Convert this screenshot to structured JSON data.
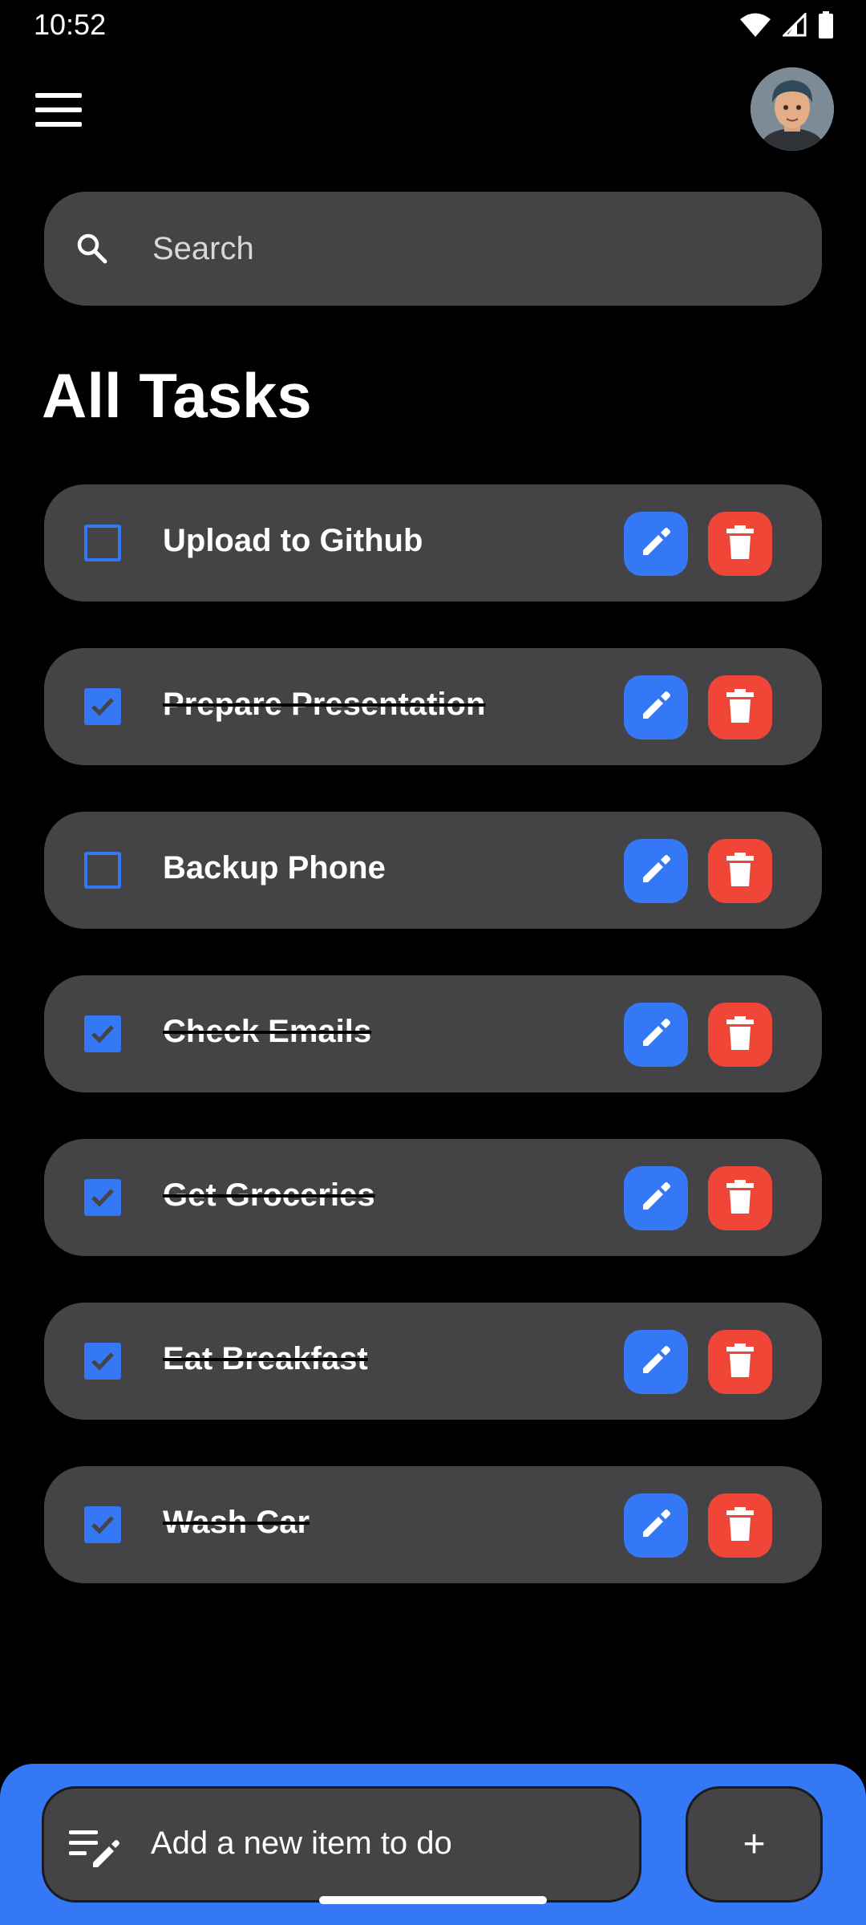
{
  "status_bar": {
    "time": "10:52",
    "icons": [
      "wifi-icon",
      "signal-icon",
      "battery-icon"
    ]
  },
  "header": {
    "menu_icon": "menu-icon",
    "avatar": "avatar"
  },
  "search": {
    "placeholder": "Search",
    "icon": "search-icon"
  },
  "page": {
    "title": "All Tasks"
  },
  "tasks": [
    {
      "title": "Upload to Github",
      "done": false
    },
    {
      "title": "Prepare Presentation",
      "done": true
    },
    {
      "title": "Backup Phone",
      "done": false
    },
    {
      "title": "Check Emails",
      "done": true
    },
    {
      "title": "Get Groceries",
      "done": true
    },
    {
      "title": "Eat Breakfast",
      "done": true
    },
    {
      "title": "Wash Car",
      "done": true
    }
  ],
  "bottom_bar": {
    "new_item_placeholder": "Add a new item to do",
    "add_label": "+"
  },
  "colors": {
    "background": "#000000",
    "card": "#444446",
    "accent": "#3478f6",
    "danger": "#f04638"
  }
}
